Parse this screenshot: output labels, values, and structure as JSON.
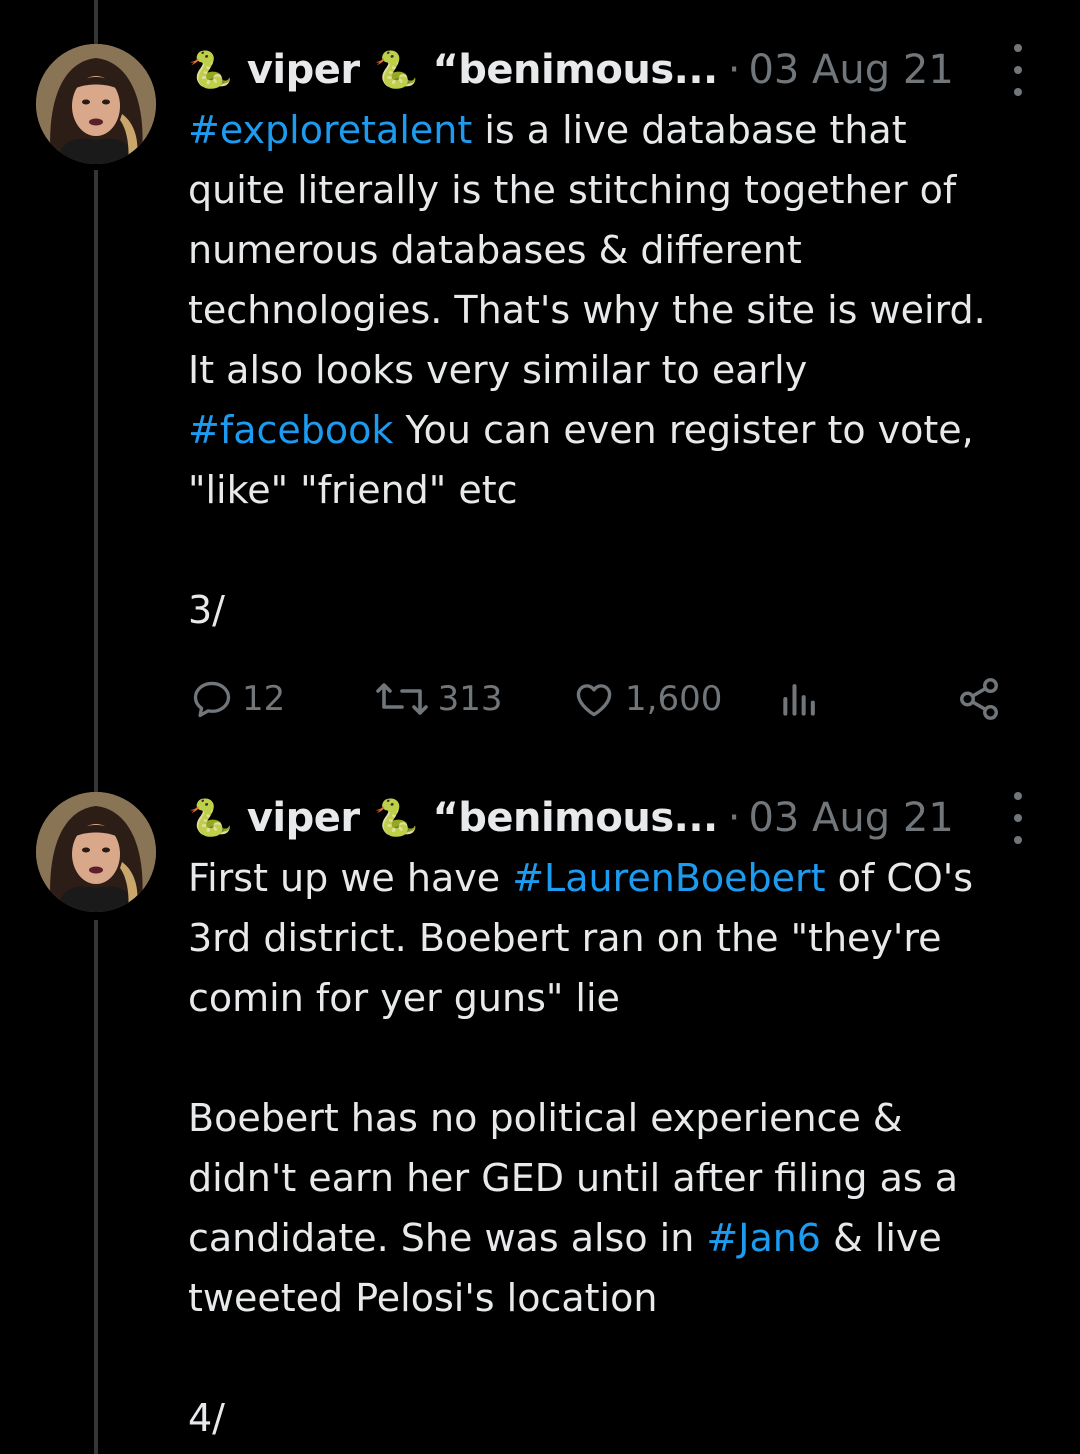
{
  "tweets": [
    {
      "author_name": "viper",
      "emoji": "🐍",
      "handle_truncated": "“benimous...",
      "separator": "·",
      "date": "03 Aug 21",
      "lines": [
        [
          {
            "t": "#exploretalent",
            "tag": true
          },
          {
            "t": " is a live database that"
          }
        ],
        [
          {
            "t": "quite literally is the stitching together of"
          }
        ],
        [
          {
            "t": "numerous databases & different"
          }
        ],
        [
          {
            "t": "technologies. That's why the site is weird."
          }
        ],
        [
          {
            "t": "It also looks very similar to early"
          }
        ],
        [
          {
            "t": "#facebook",
            "tag": true
          },
          {
            "t": " You can even register to vote,"
          }
        ],
        [
          {
            "t": "\"like\" \"friend\" etc"
          }
        ],
        [
          {
            "t": ""
          }
        ],
        [
          {
            "t": "3/"
          }
        ]
      ],
      "replies": "12",
      "retweets": "313",
      "likes": "1,600"
    },
    {
      "author_name": "viper",
      "emoji": "🐍",
      "handle_truncated": "“benimous...",
      "separator": "·",
      "date": "03 Aug 21",
      "lines": [
        [
          {
            "t": "First up we have "
          },
          {
            "t": "#LaurenBoebert",
            "tag": true
          },
          {
            "t": " of CO's"
          }
        ],
        [
          {
            "t": "3rd district. Boebert ran on the \"they're"
          }
        ],
        [
          {
            "t": "comin for yer guns\" lie"
          }
        ],
        [
          {
            "t": ""
          }
        ],
        [
          {
            "t": "Boebert has no political experience &"
          }
        ],
        [
          {
            "t": "didn't earn her GED until after filing as a"
          }
        ],
        [
          {
            "t": "candidate. She was also in "
          },
          {
            "t": "#Jan6",
            "tag": true
          },
          {
            "t": " & live"
          }
        ],
        [
          {
            "t": "tweeted Pelosi's location"
          }
        ],
        [
          {
            "t": ""
          }
        ],
        [
          {
            "t": "4/"
          }
        ]
      ]
    }
  ],
  "colors": {
    "background": "#000000",
    "text": "#e7e9ea",
    "secondary": "#71767b",
    "link": "#1d9bf0",
    "thread_line": "#333639"
  }
}
